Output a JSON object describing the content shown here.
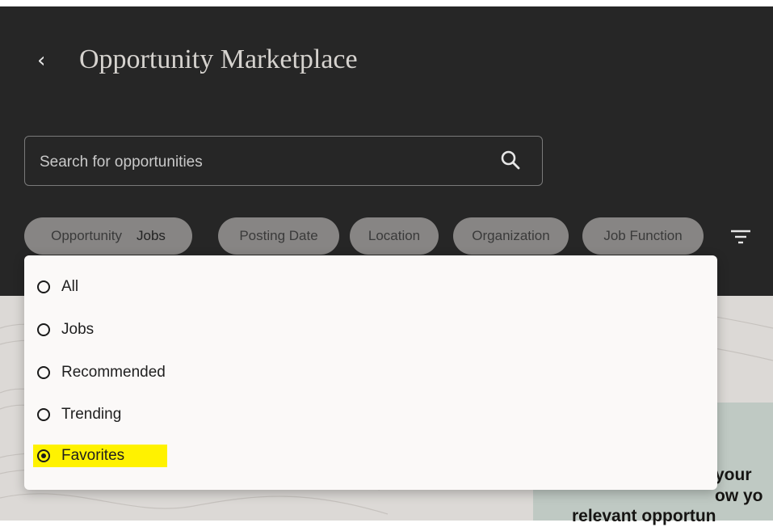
{
  "header": {
    "back_icon": "chevron-left-icon",
    "title": "Opportunity Marketplace"
  },
  "search": {
    "placeholder": "Search for opportunities",
    "icon": "search-icon"
  },
  "filters": {
    "opportunity": {
      "label": "Opportunity",
      "value": "Jobs"
    },
    "posting_date": "Posting Date",
    "location": "Location",
    "organization": "Organization",
    "job_function": "Job Function",
    "more_icon": "filter-icon"
  },
  "dropdown": {
    "options": [
      {
        "label": "All",
        "selected": false
      },
      {
        "label": "Jobs",
        "selected": false
      },
      {
        "label": "Recommended",
        "selected": false
      },
      {
        "label": "Trending",
        "selected": false
      },
      {
        "label": "Favorites",
        "selected": true
      }
    ],
    "highlight_color": "#fff200"
  },
  "promo": {
    "line1": "your",
    "line2": "ow yo",
    "line3": "relevant opportun"
  },
  "colors": {
    "header_bg": "#262626",
    "chip_bg": "#878584",
    "dropdown_bg": "#fbf9f8"
  }
}
